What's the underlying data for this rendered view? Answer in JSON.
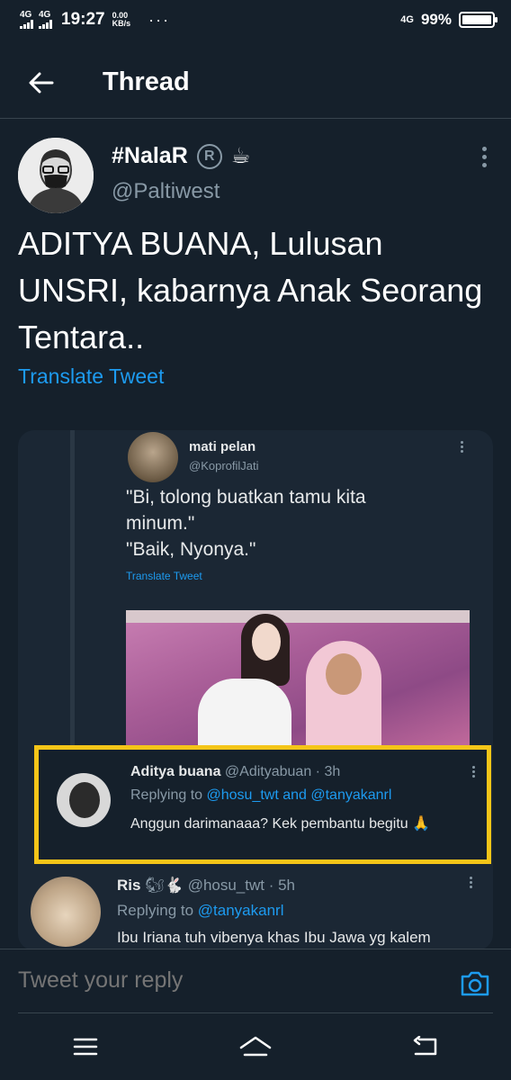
{
  "status_bar": {
    "network_1": "4G",
    "network_2": "4G",
    "time": "19:27",
    "speed_value": "0.00",
    "speed_unit": "KB/s",
    "dots": "···",
    "network_right": "4G",
    "battery": "99%"
  },
  "header": {
    "title": "Thread",
    "back_icon": "arrow-left-icon"
  },
  "tweet": {
    "author_name": "#NalaR",
    "registered_symbol": "R",
    "coffee_emoji": "☕",
    "handle": "@Paltiwest",
    "text": "ADITYA BUANA, Lulusan UNSRI, kabarnya Anak Seorang Tentara..",
    "translate_label": "Translate Tweet"
  },
  "embedded_screenshot": {
    "inner_tweet": {
      "name": "mati pelan",
      "handle": "@KoprofilJati",
      "line1": "\"Bi, tolong buatkan tamu kita minum.\"",
      "line2": "\"Baik, Nyonya.\"",
      "translate_label": "Translate Tweet"
    },
    "highlighted_reply": {
      "name": "Aditya buana",
      "handle_time": "@Adityabuan · 3h",
      "replying_prefix": "Replying to",
      "replying_to": "@hosu_twt and @tanyakanrl",
      "text": "Anggun darimanaaa? Kek pembantu begitu 🙏"
    },
    "next_reply": {
      "name": "Ris",
      "emojis": "🐿🐇",
      "handle_time": "@hosu_twt · 5h",
      "replying_prefix": "Replying to",
      "replying_to": "@tanyakanrl",
      "text": "Ibu Iriana tuh vibenya khas Ibu Jawa yg kalem"
    }
  },
  "reply_bar": {
    "placeholder": "Tweet your reply",
    "camera_icon": "camera-icon"
  },
  "nav_bar": {
    "menu_icon": "menu-icon",
    "home_icon": "home-icon",
    "back_icon": "back-icon"
  },
  "colors": {
    "background": "#15202b",
    "accent": "#1d9bf0",
    "secondary_text": "#8899a6",
    "highlight_border": "#f5c518"
  }
}
